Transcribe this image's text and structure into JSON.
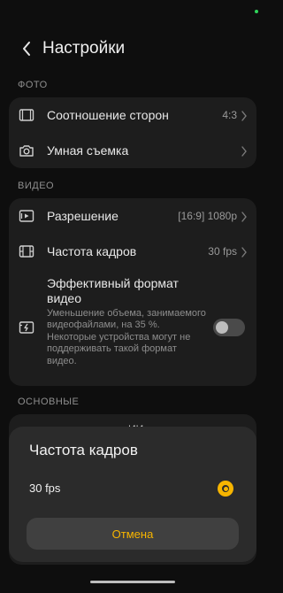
{
  "header": {
    "title": "Настройки"
  },
  "sections": {
    "photo": {
      "label": "ФОТО",
      "items": [
        {
          "label": "Соотношение сторон",
          "value": "4:3",
          "icon": "aspect-ratio-icon"
        },
        {
          "label": "Умная съемка",
          "value": "",
          "icon": "camera-icon"
        }
      ]
    },
    "video": {
      "label": "ВИДЕО",
      "items": [
        {
          "label": "Разрешение",
          "value": "[16:9] 1080p",
          "icon": "resolution-icon"
        },
        {
          "label": "Частота кадров",
          "value": "30 fps",
          "icon": "film-icon"
        }
      ],
      "efficient_format": {
        "title_line1": "Эффективный формат",
        "title_line2": "видео",
        "description": "Уменьшение объема, занимаемого видеофайлами, на 35 %. Некоторые устройства могут не поддерживать такой формат видео.",
        "enabled": false
      }
    },
    "basic": {
      "label": "ОСНОВНЫЕ",
      "partial_text": "ИИ"
    }
  },
  "dialog": {
    "title": "Частота кадров",
    "options": [
      {
        "label": "30 fps",
        "selected": true
      }
    ],
    "cancel_label": "Отмена"
  },
  "colors": {
    "accent": "#f7b500",
    "background": "#0e0e0e",
    "card": "#1d1d1d",
    "sheet": "#2b2b2b"
  }
}
